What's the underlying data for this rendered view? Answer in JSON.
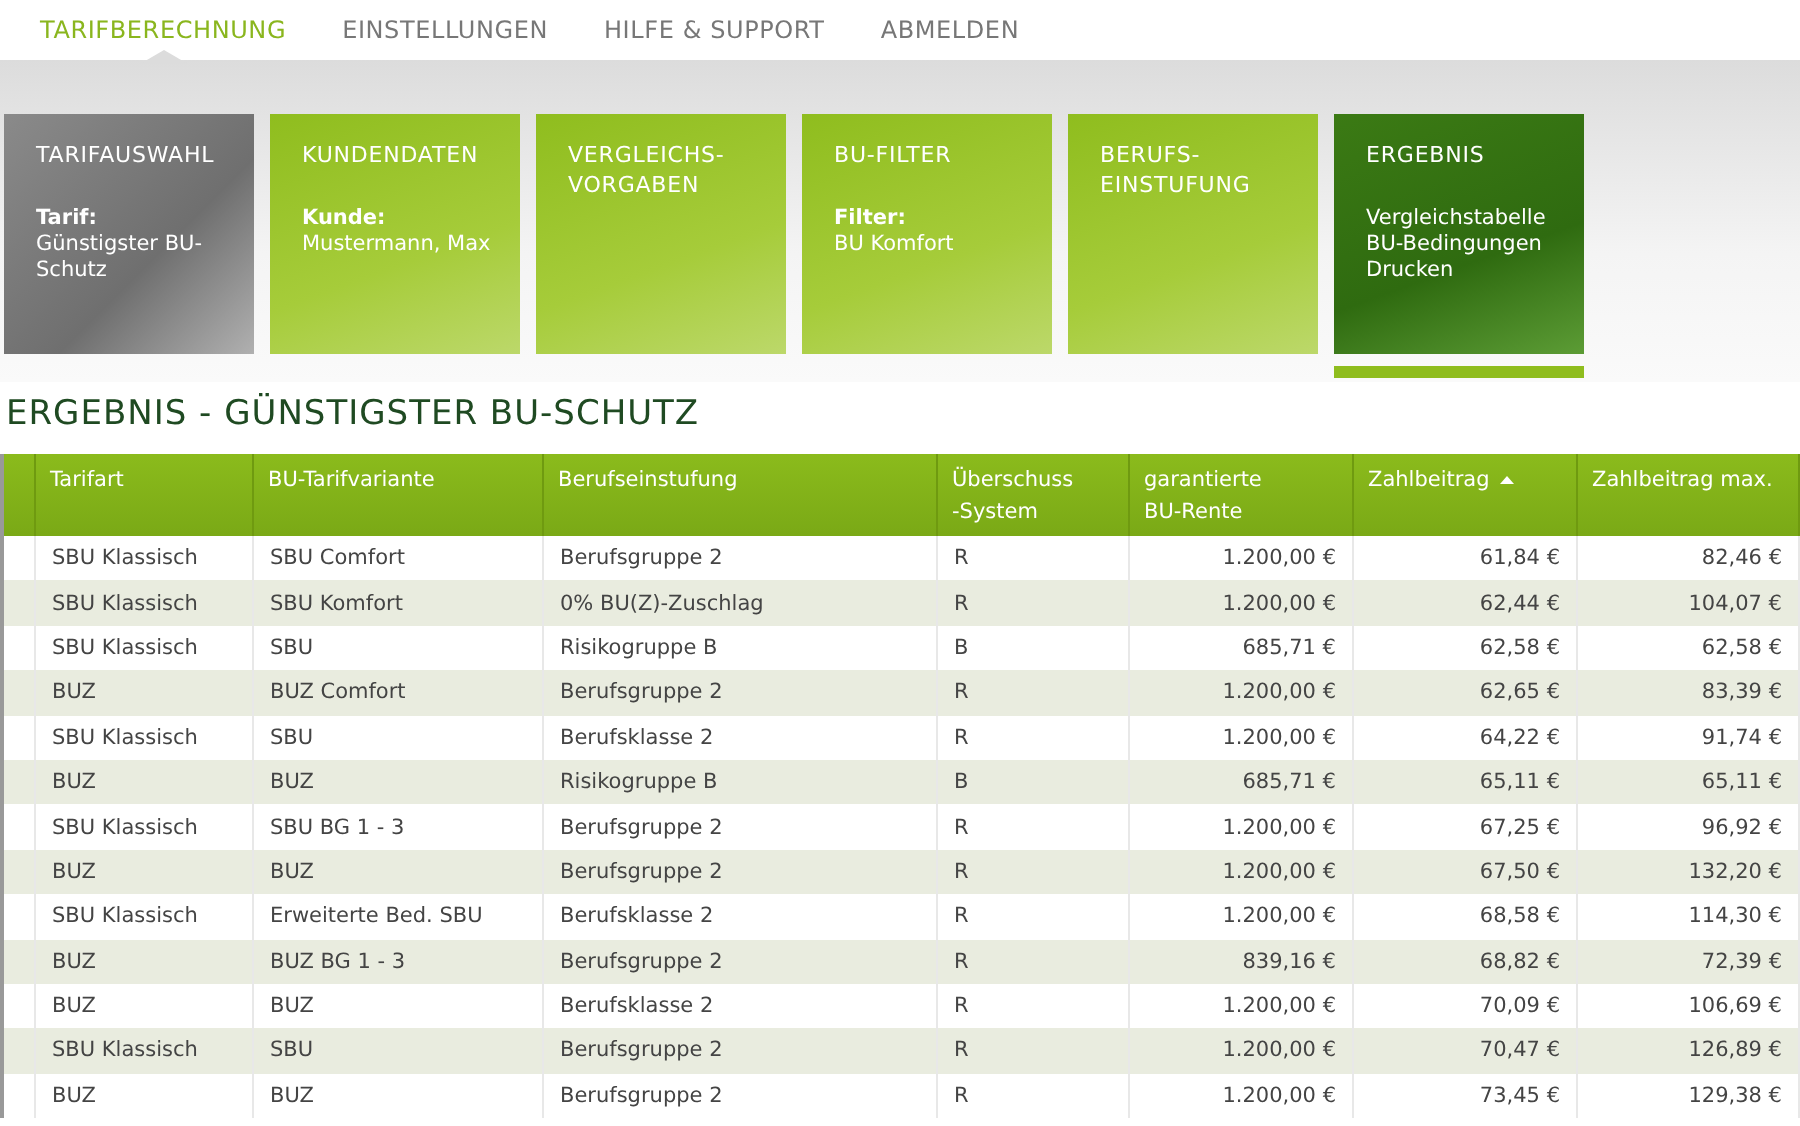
{
  "nav": [
    {
      "label": "TARIFBERECHNUNG",
      "selected": true
    },
    {
      "label": "EINSTELLUNGEN",
      "selected": false
    },
    {
      "label": "HILFE & SUPPORT",
      "selected": false
    },
    {
      "label": "ABMELDEN",
      "selected": false
    }
  ],
  "steps": [
    {
      "title": "TARIFAUSWAHL",
      "completed": true,
      "selected": false,
      "detail_label": "Tarif:",
      "lines": [
        "Günstigster BU-Schutz"
      ]
    },
    {
      "title": "KUNDENDATEN",
      "completed": false,
      "selected": false,
      "detail_label": "Kunde:",
      "lines": [
        "Mustermann, Max"
      ]
    },
    {
      "title": "VERGLEICHS-VORGABEN",
      "completed": false,
      "selected": false
    },
    {
      "title": "BU-FILTER",
      "completed": false,
      "selected": false,
      "detail_label": "Filter:",
      "lines": [
        "BU Komfort"
      ]
    },
    {
      "title": "BERUFS-EINSTUFUNG",
      "completed": false,
      "selected": false
    },
    {
      "title": "ERGEBNIS",
      "completed": false,
      "selected": true,
      "lines": [
        "Vergleichstabelle",
        "BU-Bedingungen",
        "Drucken"
      ]
    }
  ],
  "heading": "ERGEBNIS - GÜNSTIGSTER BU-SCHUTZ",
  "table": {
    "columns": [
      {
        "label": "Tarifart",
        "sorted": false
      },
      {
        "label": "BU-Tarifvariante",
        "sorted": false
      },
      {
        "label": "Berufseinstufung",
        "sorted": false
      },
      {
        "label": "Überschuss -System",
        "sorted": false
      },
      {
        "label": "garantierte BU-Rente",
        "sorted": false
      },
      {
        "label": "Zahlbeitrag",
        "sorted": true
      },
      {
        "label": "Zahlbeitrag max.",
        "sorted": false
      }
    ],
    "rows": [
      [
        "SBU Klassisch",
        "SBU Comfort",
        "Berufsgruppe 2",
        "R",
        "1.200,00 €",
        "61,84 €",
        "82,46 €"
      ],
      [
        "SBU Klassisch",
        "SBU Komfort",
        "0% BU(Z)-Zuschlag",
        "R",
        "1.200,00 €",
        "62,44 €",
        "104,07 €"
      ],
      [
        "SBU Klassisch",
        "SBU",
        "Risikogruppe B",
        "B",
        "685,71 €",
        "62,58 €",
        "62,58 €"
      ],
      [
        "BUZ",
        "BUZ Comfort",
        "Berufsgruppe 2",
        "R",
        "1.200,00 €",
        "62,65 €",
        "83,39 €"
      ],
      [
        "SBU Klassisch",
        "SBU",
        "Berufsklasse 2",
        "R",
        "1.200,00 €",
        "64,22 €",
        "91,74 €"
      ],
      [
        "BUZ",
        "BUZ",
        "Risikogruppe B",
        "B",
        "685,71 €",
        "65,11 €",
        "65,11 €"
      ],
      [
        "SBU Klassisch",
        "SBU BG 1 - 3",
        "Berufsgruppe 2",
        "R",
        "1.200,00 €",
        "67,25 €",
        "96,92 €"
      ],
      [
        "BUZ",
        "BUZ",
        "Berufsgruppe 2",
        "R",
        "1.200,00 €",
        "67,50 €",
        "132,20 €"
      ],
      [
        "SBU Klassisch",
        "Erweiterte Bed. SBU",
        "Berufsklasse 2",
        "R",
        "1.200,00 €",
        "68,58 €",
        "114,30 €"
      ],
      [
        "BUZ",
        "BUZ BG 1 - 3",
        "Berufsgruppe 2",
        "R",
        "839,16 €",
        "68,82 €",
        "72,39 €"
      ],
      [
        "BUZ",
        "BUZ",
        "Berufsklasse 2",
        "R",
        "1.200,00 €",
        "70,09 €",
        "106,69 €"
      ],
      [
        "SBU Klassisch",
        "SBU",
        "Berufsgruppe 2",
        "R",
        "1.200,00 €",
        "70,47 €",
        "126,89 €"
      ],
      [
        "BUZ",
        "BUZ",
        "Berufsgruppe 2",
        "R",
        "1.200,00 €",
        "73,45 €",
        "129,38 €"
      ]
    ]
  }
}
